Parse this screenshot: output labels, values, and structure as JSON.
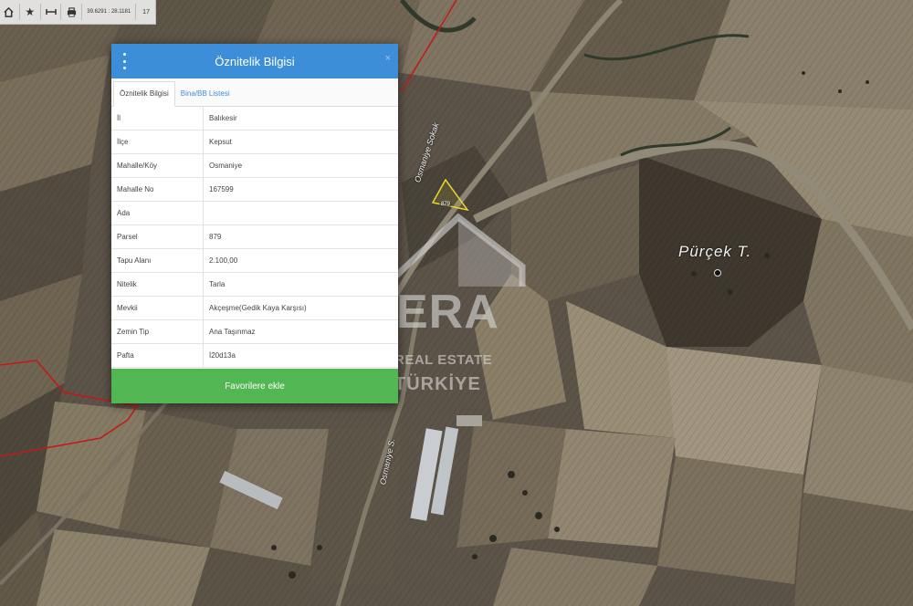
{
  "toolbar": {
    "coordinates": "39.6291 : 28.1181",
    "zoom": "17",
    "icons": [
      "home-icon",
      "star-icon",
      "measure-icon",
      "print-icon"
    ]
  },
  "panel": {
    "title": "Öznitelik Bilgisi",
    "close": "×",
    "tabs": [
      {
        "label": "Öznitelik Bilgisi",
        "active": true
      },
      {
        "label": "Bina/BB Listesi",
        "active": false
      }
    ],
    "rows": [
      {
        "key": "İl",
        "value": "Balıkesir"
      },
      {
        "key": "İlçe",
        "value": "Kepsut"
      },
      {
        "key": "Mahalle/Köy",
        "value": "Osmaniye"
      },
      {
        "key": "Mahalle No",
        "value": "167599"
      },
      {
        "key": "Ada",
        "value": ""
      },
      {
        "key": "Parsel",
        "value": "879"
      },
      {
        "key": "Tapu Alanı",
        "value": "2.100,00"
      },
      {
        "key": "Nitelik",
        "value": "Tarla"
      },
      {
        "key": "Mevkii",
        "value": "Akçeşme(Gedik Kaya Karşısı)"
      },
      {
        "key": "Zemin Tip",
        "value": "Ana Taşınmaz"
      },
      {
        "key": "Pafta",
        "value": "İ20d13a"
      }
    ],
    "favorite_label": "Favorilere ekle"
  },
  "map": {
    "hill_label": "Pürçek T.",
    "street_upper": "Osmaniye Sokak",
    "street_lower": "Osmaniye S.",
    "parcel_label": "879"
  },
  "watermark": {
    "brand": "ERA",
    "line1": "REAL ESTATE",
    "line2": "TÜRKİYE"
  },
  "colors": {
    "header": "#3d8ed8",
    "favorite_button": "#52b653",
    "parcel_outline": "#e8d830",
    "boundary": "#c41818"
  }
}
